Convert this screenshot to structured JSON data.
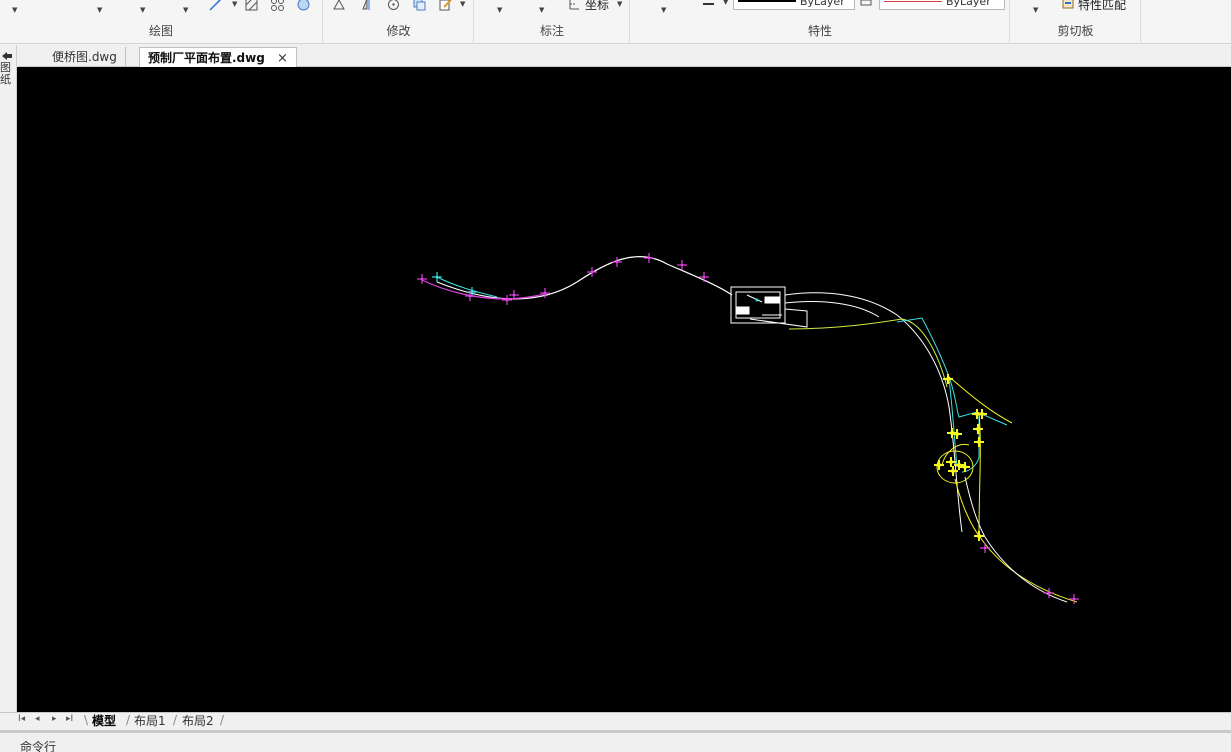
{
  "ribbon": {
    "groups": {
      "draw": {
        "label": "绘图"
      },
      "modify": {
        "label": "修改"
      },
      "annotate": {
        "label": "标注",
        "coord_label": "坐标"
      },
      "properties": {
        "label": "特性",
        "color_value": "ByLayer",
        "linetype_value": "ByLayer"
      },
      "clipboard": {
        "label": "剪切板",
        "match_label": "特性匹配"
      }
    }
  },
  "tabs": [
    {
      "label": "便桥图.dwg",
      "active": false
    },
    {
      "label": "预制厂平面布置.dwg",
      "active": true
    }
  ],
  "tab_close": "×",
  "left_strip": {
    "text": "图纸"
  },
  "layout_tabs": [
    {
      "label": "模型",
      "active": true
    },
    {
      "label": "布局1",
      "active": false
    },
    {
      "label": "布局2",
      "active": false
    }
  ],
  "command_line": {
    "label": "命令行"
  },
  "colors": {
    "canvas_bg": "#000000",
    "white_line": "#ffffff",
    "magenta": "#e040e0",
    "cyan": "#3de0e0",
    "yellow": "#f5f520",
    "linetype_red": "#d04040"
  }
}
